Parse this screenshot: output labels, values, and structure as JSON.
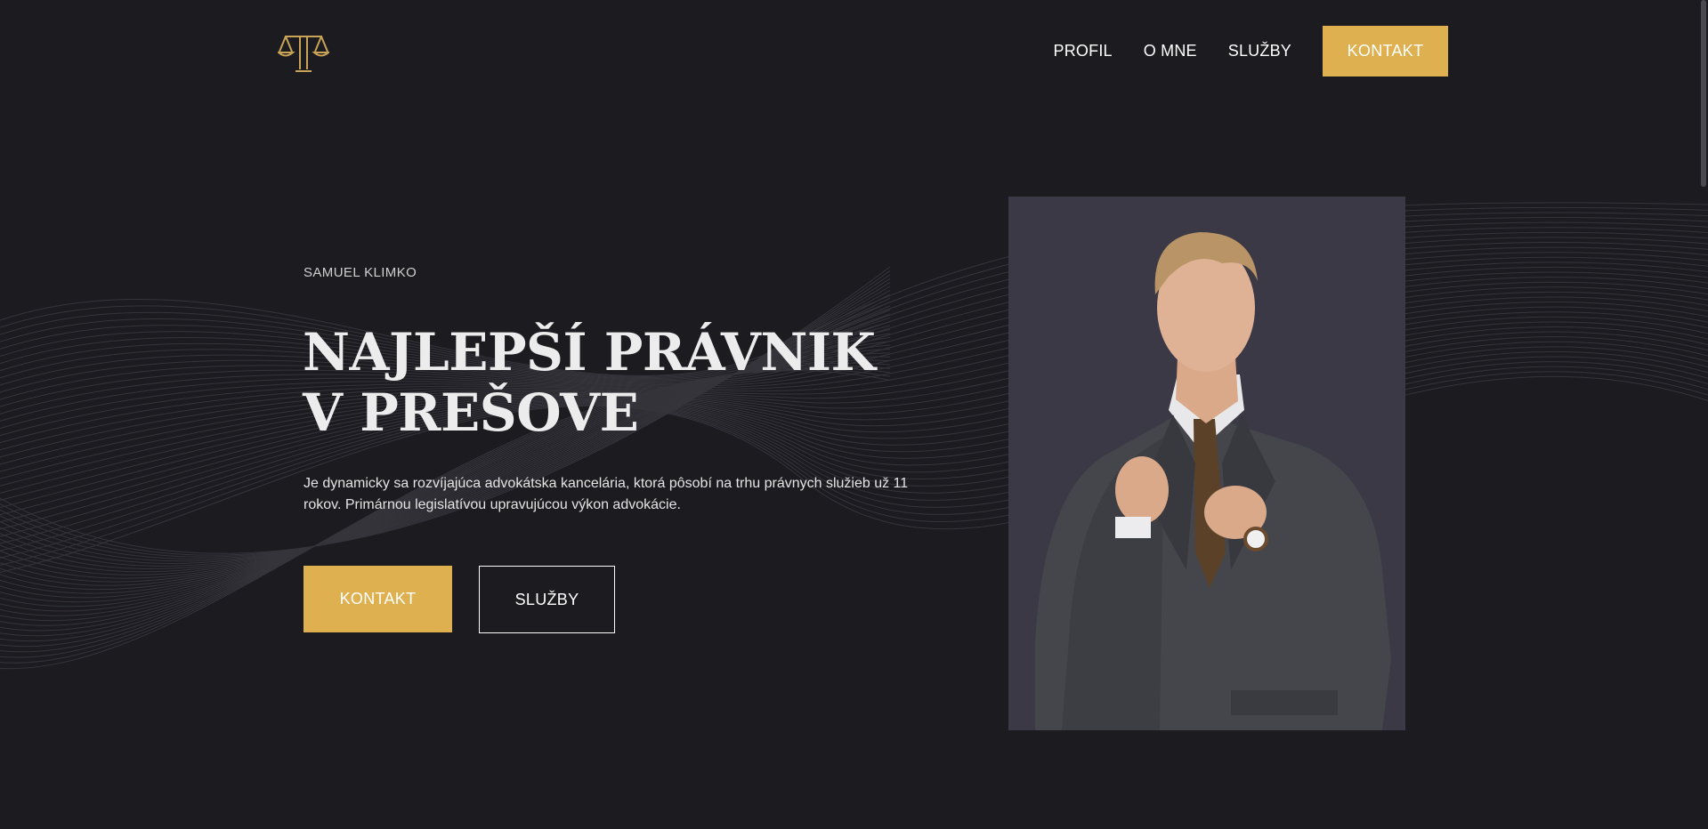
{
  "header": {
    "logo_icon": "scales-of-justice-icon",
    "nav": [
      {
        "label": "PROFIL"
      },
      {
        "label": "O MNE"
      },
      {
        "label": "SLUŽBY"
      }
    ],
    "cta_label": "KONTAKT"
  },
  "hero": {
    "eyebrow": "SAMUEL KLIMKO",
    "headline": "NAJLEPŠÍ PRÁVNIK V PREŠOVE",
    "description": "Je dynamicky sa rozvíjajúca advokátska kancelária, ktorá pôsobí na trhu právnych služieb už 11 rokov. Primárnou legislatívou upravujúcou výkon advokácie.",
    "primary_button": "KONTAKT",
    "secondary_button": "SLUŽBY",
    "portrait_icon": "lawyer-portrait-photo"
  },
  "colors": {
    "background": "#1c1b20",
    "accent": "#deb04f",
    "portrait_bg": "#3a3945",
    "text": "#ffffff"
  }
}
